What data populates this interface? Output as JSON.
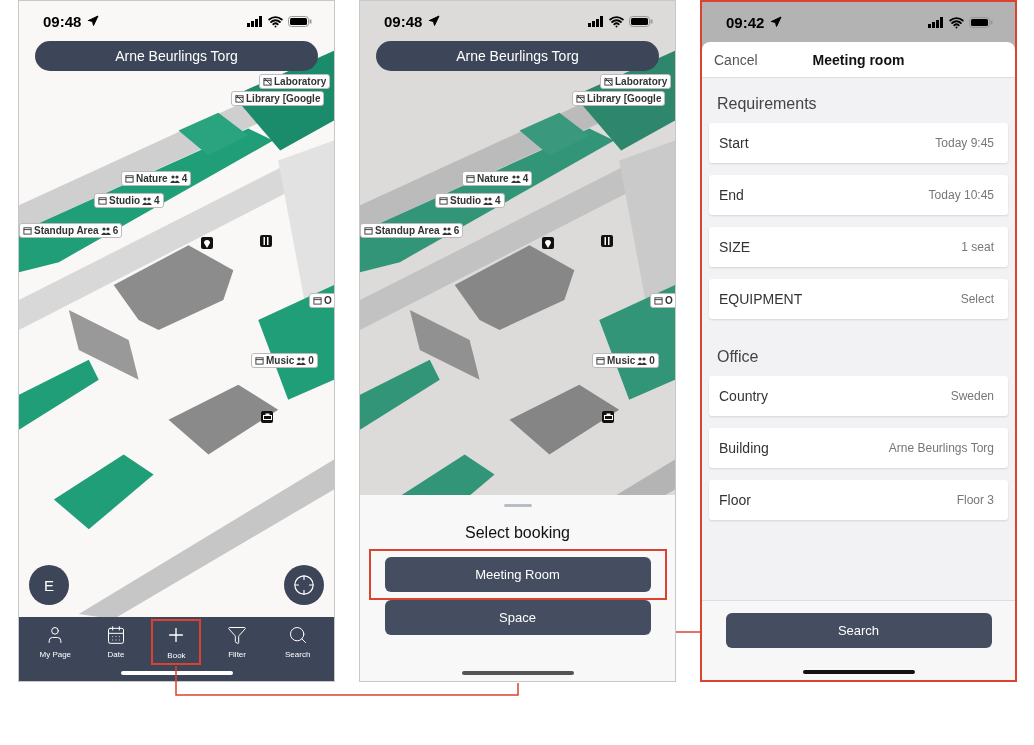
{
  "screens": [
    {
      "kind": "map",
      "highlighted": false,
      "status_time": "09:48",
      "building": "Arne Beurlings Torg",
      "dimmed": false,
      "map_labels": [
        {
          "name": "Laboratory",
          "bookable": false
        },
        {
          "name": "Library [Google",
          "bookable": false
        },
        {
          "name": "Nature",
          "count": "4",
          "bookable": true
        },
        {
          "name": "Studio",
          "count": "4",
          "bookable": true
        },
        {
          "name": "Standup Area",
          "count": "6",
          "bookable": true
        },
        {
          "name": "O",
          "bookable": true
        },
        {
          "name": "Music",
          "count": "0",
          "bookable": true
        }
      ],
      "avatar": "E",
      "tabs": [
        {
          "label": "My Page",
          "highlighted": false
        },
        {
          "label": "Date",
          "highlighted": false
        },
        {
          "label": "Book",
          "highlighted": true
        },
        {
          "label": "Filter",
          "highlighted": false
        },
        {
          "label": "Search",
          "highlighted": false
        }
      ]
    },
    {
      "kind": "map",
      "highlighted": false,
      "status_time": "09:48",
      "building": "Arne Beurlings Torg",
      "dimmed": true,
      "map_labels": [
        {
          "name": "Laboratory",
          "bookable": false
        },
        {
          "name": "Library [Google",
          "bookable": false
        },
        {
          "name": "Nature",
          "count": "4",
          "bookable": true
        },
        {
          "name": "Studio",
          "count": "4",
          "bookable": true
        },
        {
          "name": "Standup Area",
          "count": "6",
          "bookable": true
        },
        {
          "name": "O",
          "bookable": true
        },
        {
          "name": "Music",
          "count": "0",
          "bookable": true
        }
      ],
      "sheet": {
        "title": "Select booking",
        "buttons": [
          {
            "label": "Meeting Room",
            "highlighted": true
          },
          {
            "label": "Space",
            "highlighted": false
          }
        ]
      }
    },
    {
      "kind": "form",
      "highlighted": true,
      "status_time": "09:42",
      "cancel": "Cancel",
      "title": "Meeting room",
      "sections": [
        {
          "title": "Requirements",
          "rows": [
            {
              "label": "Start",
              "value": "Today 9:45"
            },
            {
              "label": "End",
              "value": "Today 10:45"
            },
            {
              "label": "SIZE",
              "value": "1 seat"
            },
            {
              "label": "EQUIPMENT",
              "value": "Select"
            }
          ]
        },
        {
          "title": "Office",
          "rows": [
            {
              "label": "Country",
              "value": "Sweden"
            },
            {
              "label": "Building",
              "value": "Arne Beurlings Torg"
            },
            {
              "label": "Floor",
              "value": "Floor 3"
            }
          ]
        }
      ],
      "search_button": "Search"
    }
  ]
}
